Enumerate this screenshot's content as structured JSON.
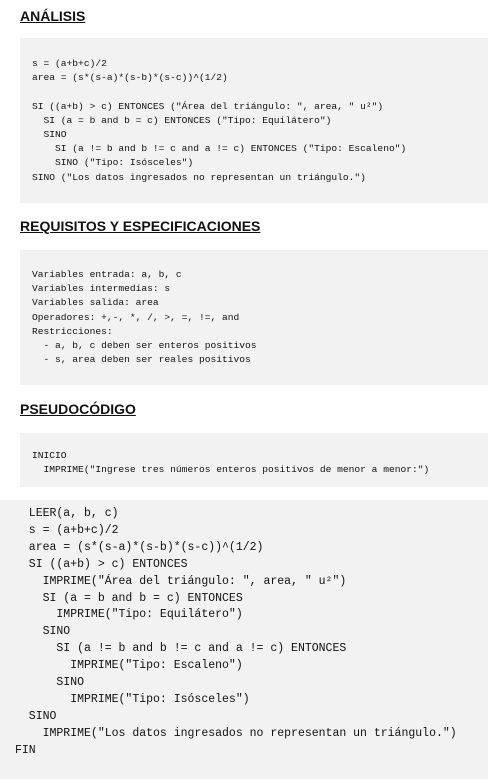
{
  "sections": {
    "analisis": {
      "title": "ANÁLISIS",
      "code": "s = (a+b+c)/2\narea = (s*(s-a)*(s-b)*(s-c))^(1/2)\n\nSI ((a+b) > c) ENTONCES (\"Área del triángulo: \", area, \" u²\")\n  SI (a = b and b = c) ENTONCES (\"Tipo: Equilátero\")\n  SINO\n    SI (a != b and b != c and a != c) ENTONCES (\"Tipo: Escaleno\")\n    SINO (\"Tipo: Isósceles\")\nSINO (\"Los datos ingresados no representan un triángulo.\")"
    },
    "requisitos": {
      "title": "REQUISITOS Y ESPECIFICACIONES",
      "code": "Variables entrada: a, b, c\nVariables intermedias: s\nVariables salida: area\nOperadores: +,-, *, /, >, =, !=, and\nRestricciones:\n  - a, b, c deben ser enteros positivos\n  - s, area deben ser reales positivos"
    },
    "pseudocodigo": {
      "title": "PSEUDOCÓDIGO",
      "code_start": "INICIO\n  IMPRIME(\"Ingrese tres números enteros positivos de menor a menor:\")",
      "code_body": "  LEER(a, b, c)\n  s = (a+b+c)/2\n  area = (s*(s-a)*(s-b)*(s-c))^(1/2)\n  SI ((a+b) > c) ENTONCES\n    IMPRIME(\"Área del triángulo: \", area, \" u²\")\n    SI (a = b and b = c) ENTONCES\n      IMPRIME(\"Tipo: Equilátero\")\n    SINO\n      SI (a != b and b != c and a != c) ENTONCES\n        IMPRIME(\"Tipo: Escaleno\")\n      SINO\n        IMPRIME(\"Tipo: Isósceles\")\n  SINO\n    IMPRIME(\"Los datos ingresados no representan un triángulo.\")\nFIN"
    }
  }
}
